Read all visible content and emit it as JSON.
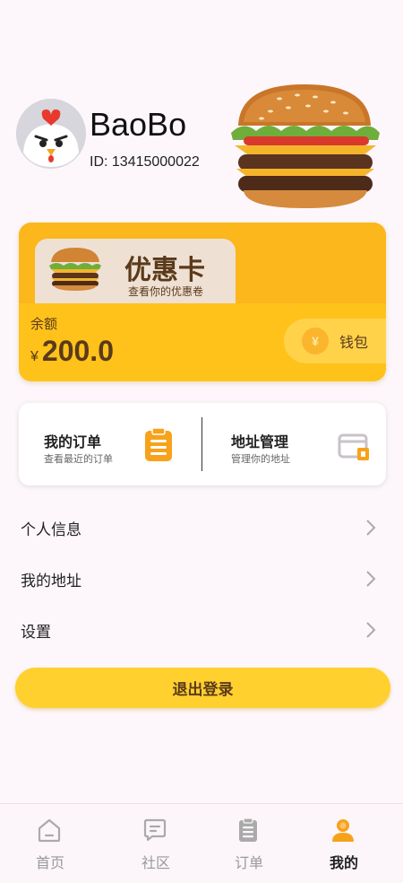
{
  "profile": {
    "username": "BaoBo",
    "user_id": "ID: 13415000022"
  },
  "card": {
    "coupon_title": "优惠卡",
    "coupon_subtitle": "查看你的优惠卷",
    "balance_label": "余额",
    "currency_symbol": "¥",
    "balance_amount": "200.0",
    "wallet_coin_symbol": "¥",
    "wallet_label": "钱包"
  },
  "quick_actions": [
    {
      "title": "我的订单",
      "subtitle": "查看最近的订单",
      "icon": "clipboard-icon"
    },
    {
      "title": "地址管理",
      "subtitle": "管理你的地址",
      "icon": "address-card-icon"
    }
  ],
  "menu": [
    {
      "label": "个人信息"
    },
    {
      "label": "我的地址"
    },
    {
      "label": "设置"
    }
  ],
  "logout_label": "退出登录",
  "tabs": [
    {
      "label": "首页",
      "icon": "home-icon",
      "active": false
    },
    {
      "label": "社区",
      "icon": "chat-icon",
      "active": false
    },
    {
      "label": "订单",
      "icon": "orders-icon",
      "active": false
    },
    {
      "label": "我的",
      "icon": "profile-icon",
      "active": true
    }
  ],
  "colors": {
    "accent": "#ffc21a",
    "accent_dark": "#fbb71b",
    "text_brown": "#5a3a1a",
    "background": "#fdf7fc",
    "tab_inactive": "#999999",
    "tab_active": "#222222"
  }
}
